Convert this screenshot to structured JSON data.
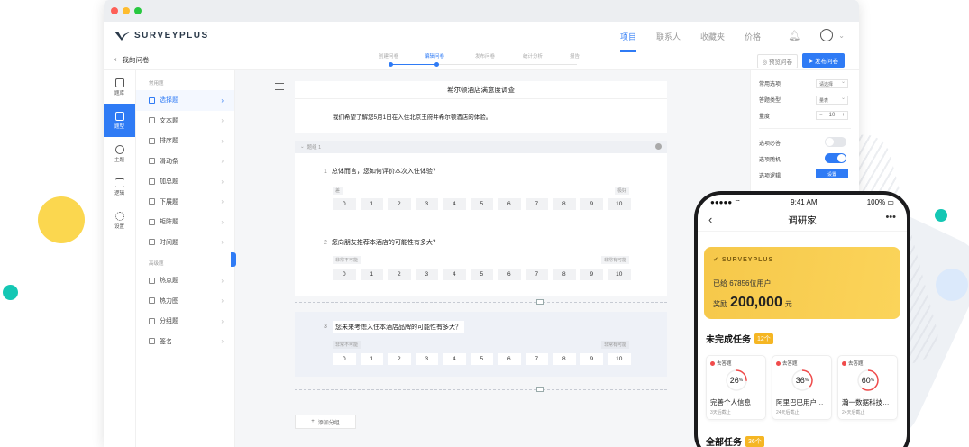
{
  "window": {
    "logo": "SURVEYPLUS",
    "nav": [
      "项目",
      "联系人",
      "收藏夹",
      "价格"
    ],
    "back_label": "我的问卷",
    "steps": [
      "创建问卷",
      "编辑问卷",
      "发布问卷",
      "统计分析",
      "报告"
    ],
    "preview_label": "预览问卷",
    "publish_label": "发布问卷"
  },
  "rail": [
    {
      "label": "题库",
      "icon": "home-icon"
    },
    {
      "label": "题型",
      "icon": "question-type-icon"
    },
    {
      "label": "主题",
      "icon": "theme-icon"
    },
    {
      "label": "逻辑",
      "icon": "logic-icon"
    },
    {
      "label": "设置",
      "icon": "settings-icon"
    }
  ],
  "menu": {
    "group_common": "常用题",
    "common": [
      "选择题",
      "文本题",
      "排序题",
      "滑动条",
      "加总题",
      "下展题",
      "矩阵题",
      "时间题"
    ],
    "group_advanced": "高级题",
    "advanced": [
      "热点题",
      "热力图",
      "分组题",
      "签名"
    ]
  },
  "survey": {
    "title": "希尔顿酒店满意度调查",
    "description": "我们希望了解您5月1日在入住北京王府井希尔顿酒店的体验。",
    "group_label": "题组 1",
    "q1": {
      "num": "1",
      "text": "总体而言，您如何评价本次入住体验？",
      "low": "差",
      "high": "极好"
    },
    "q2": {
      "num": "2",
      "text": "您向朋友推荐本酒店的可能性有多大？",
      "low": "非常不可能",
      "high": "非常有可能"
    },
    "q3": {
      "num": "3",
      "text": "您未来考虑入住本酒店品牌的可能性有多大？",
      "low": "非常不可能",
      "high": "非常有可能"
    },
    "scale": [
      "0",
      "1",
      "2",
      "3",
      "4",
      "5",
      "6",
      "7",
      "8",
      "9",
      "10"
    ],
    "add_group": "添加分组"
  },
  "props": {
    "common_option": "常用选项",
    "common_option_value": "请选择",
    "matrix_type": "答题类型",
    "matrix_type_value": "量表",
    "quantity": "量度",
    "quantity_value": "10",
    "required": "选项必答",
    "random": "选项随机",
    "logic": "选项逻辑",
    "logic_btn": "设置"
  },
  "phone": {
    "time": "9:41 AM",
    "battery": "100%",
    "title": "调研家",
    "logo": "SURVEYPLUS",
    "users": "已给 67856位用户",
    "reward_label": "奖励",
    "reward_value": "200,000",
    "reward_unit": "元",
    "pending_title": "未完成任务",
    "pending_count": "12个",
    "all_title": "全部任务",
    "all_count": "36个",
    "tasks": [
      {
        "tag": "去答题",
        "percent": 26,
        "name": "完善个人信息",
        "expire": "3天后截止"
      },
      {
        "tag": "去答题",
        "percent": 36,
        "name": "阿里巴巴用户…",
        "expire": "24天后截止"
      },
      {
        "tag": "去答题",
        "percent": 60,
        "name": "瀚一数据科技…",
        "expire": "24天后截止"
      }
    ]
  },
  "colors": {
    "primary": "#2f7bf5",
    "gold": "#f6c84a",
    "ring": "#f04b4b"
  }
}
